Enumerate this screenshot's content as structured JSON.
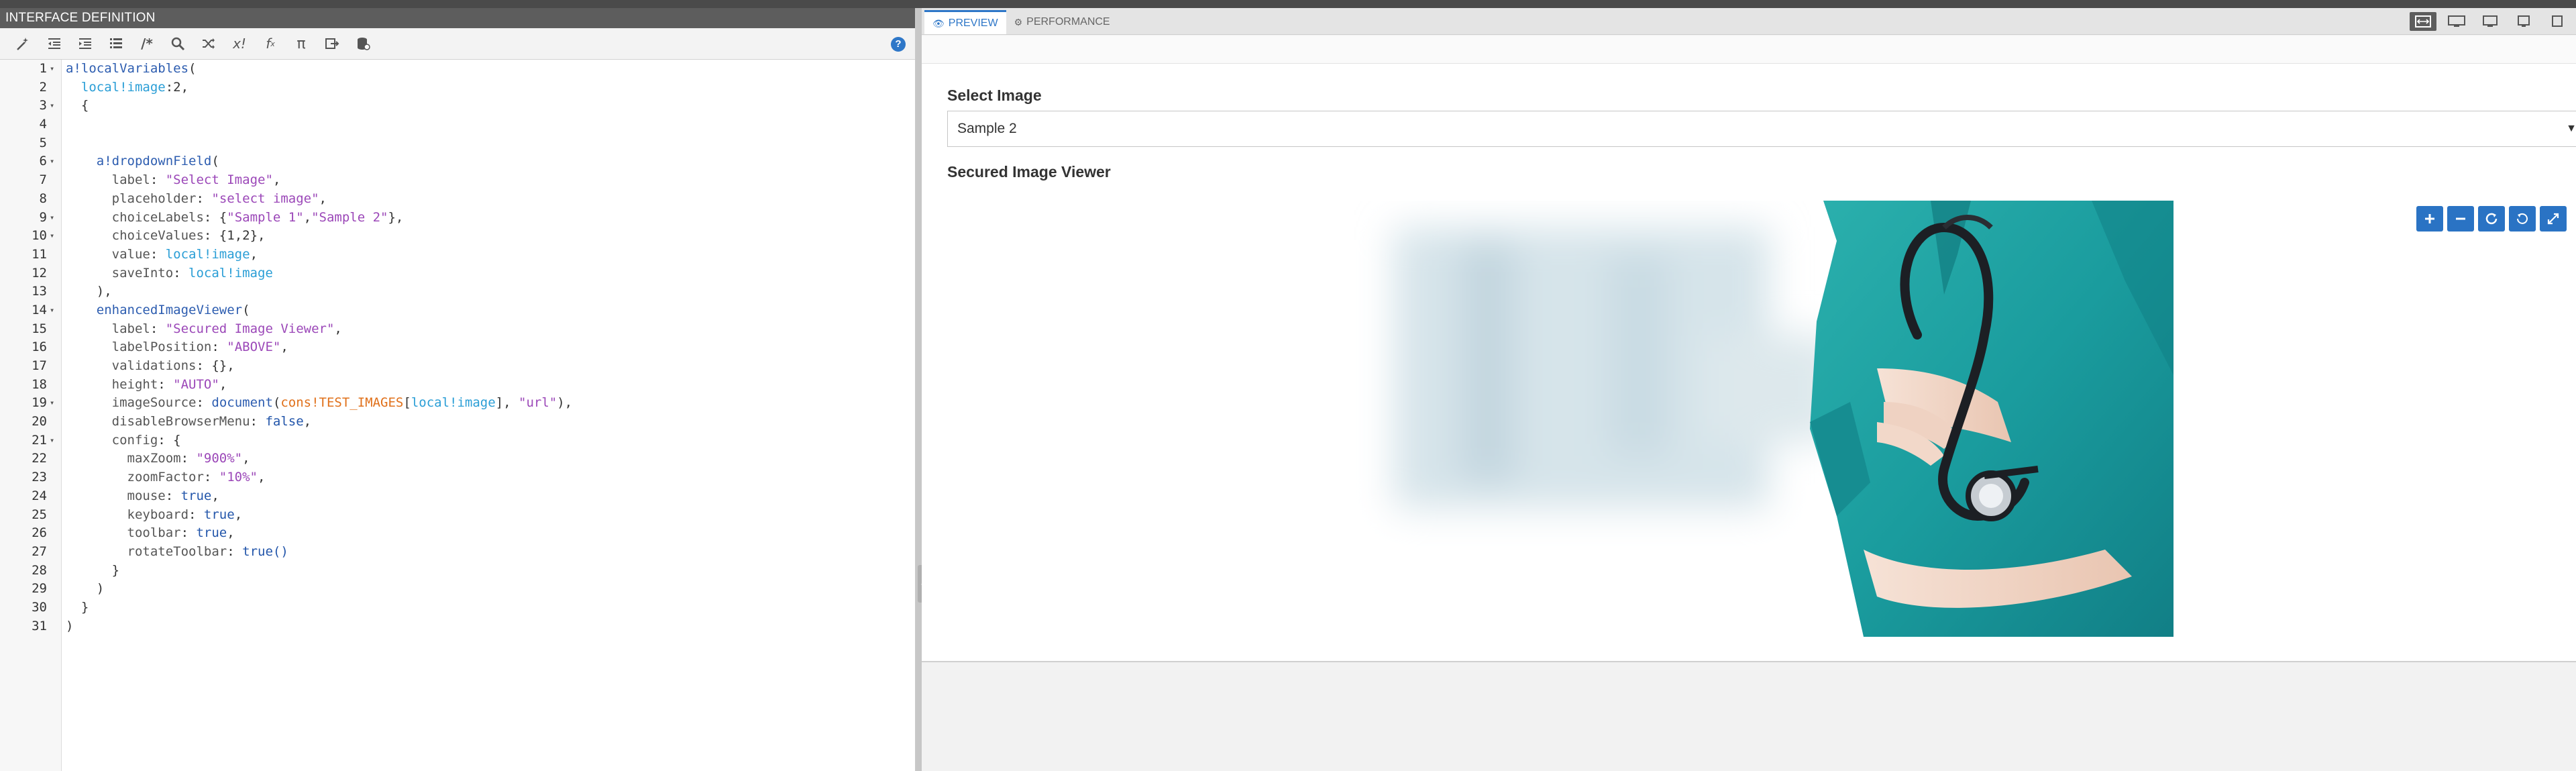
{
  "editor": {
    "title": "INTERFACE DEFINITION",
    "help_label": "?",
    "toolbar_icons": [
      "wand-icon",
      "outdent-icon",
      "indent-icon",
      "list-icon",
      "comment-icon",
      "search-icon",
      "shuffle-icon",
      "expression-icon",
      "function-icon",
      "pi-icon",
      "export-icon",
      "database-icon"
    ],
    "code": [
      {
        "n": "1",
        "fold": "▾",
        "parts": [
          [
            "fn",
            "a!localVariables"
          ],
          [
            "p",
            "("
          ]
        ]
      },
      {
        "n": "2",
        "fold": "",
        "parts": [
          [
            "p",
            "  "
          ],
          [
            "var",
            "local!image"
          ],
          [
            "p",
            ":2,"
          ]
        ]
      },
      {
        "n": "3",
        "fold": "▾",
        "parts": [
          [
            "p",
            "  {"
          ]
        ]
      },
      {
        "n": "4",
        "fold": "",
        "parts": []
      },
      {
        "n": "5",
        "fold": "",
        "parts": []
      },
      {
        "n": "6",
        "fold": "▾",
        "parts": [
          [
            "p",
            "    "
          ],
          [
            "fn",
            "a!dropdownField"
          ],
          [
            "p",
            "("
          ]
        ]
      },
      {
        "n": "7",
        "fold": "",
        "parts": [
          [
            "p",
            "      "
          ],
          [
            "key",
            "label"
          ],
          [
            "p",
            ": "
          ],
          [
            "str",
            "\"Select Image\""
          ],
          [
            "p",
            ","
          ]
        ]
      },
      {
        "n": "8",
        "fold": "",
        "parts": [
          [
            "p",
            "      "
          ],
          [
            "key",
            "placeholder"
          ],
          [
            "p",
            ": "
          ],
          [
            "str",
            "\"select image\""
          ],
          [
            "p",
            ","
          ]
        ]
      },
      {
        "n": "9",
        "fold": "▾",
        "parts": [
          [
            "p",
            "      "
          ],
          [
            "key",
            "choiceLabels"
          ],
          [
            "p",
            ": {"
          ],
          [
            "str",
            "\"Sample 1\""
          ],
          [
            "p",
            ","
          ],
          [
            "str",
            "\"Sample 2\""
          ],
          [
            "p",
            "},"
          ]
        ]
      },
      {
        "n": "10",
        "fold": "▾",
        "parts": [
          [
            "p",
            "      "
          ],
          [
            "key",
            "choiceValues"
          ],
          [
            "p",
            ": {"
          ],
          [
            "num",
            "1,2"
          ],
          [
            "p",
            "},"
          ]
        ]
      },
      {
        "n": "11",
        "fold": "",
        "parts": [
          [
            "p",
            "      "
          ],
          [
            "key",
            "value"
          ],
          [
            "p",
            ": "
          ],
          [
            "var",
            "local!image"
          ],
          [
            "p",
            ","
          ]
        ]
      },
      {
        "n": "12",
        "fold": "",
        "parts": [
          [
            "p",
            "      "
          ],
          [
            "key",
            "saveInto"
          ],
          [
            "p",
            ": "
          ],
          [
            "var",
            "local!image"
          ]
        ]
      },
      {
        "n": "13",
        "fold": "",
        "parts": [
          [
            "p",
            "    ),"
          ]
        ]
      },
      {
        "n": "14",
        "fold": "▾",
        "parts": [
          [
            "p",
            "    "
          ],
          [
            "fn",
            "enhancedImageViewer"
          ],
          [
            "p",
            "("
          ]
        ]
      },
      {
        "n": "15",
        "fold": "",
        "parts": [
          [
            "p",
            "      "
          ],
          [
            "key",
            "label"
          ],
          [
            "p",
            ": "
          ],
          [
            "str",
            "\"Secured Image Viewer\""
          ],
          [
            "p",
            ","
          ]
        ]
      },
      {
        "n": "16",
        "fold": "",
        "parts": [
          [
            "p",
            "      "
          ],
          [
            "key",
            "labelPosition"
          ],
          [
            "p",
            ": "
          ],
          [
            "str",
            "\"ABOVE\""
          ],
          [
            "p",
            ","
          ]
        ]
      },
      {
        "n": "17",
        "fold": "",
        "parts": [
          [
            "p",
            "      "
          ],
          [
            "key",
            "validations"
          ],
          [
            "p",
            ": {},"
          ]
        ]
      },
      {
        "n": "18",
        "fold": "",
        "parts": [
          [
            "p",
            "      "
          ],
          [
            "key",
            "height"
          ],
          [
            "p",
            ": "
          ],
          [
            "str",
            "\"AUTO\""
          ],
          [
            "p",
            ","
          ]
        ]
      },
      {
        "n": "19",
        "fold": "▾",
        "parts": [
          [
            "p",
            "      "
          ],
          [
            "key",
            "imageSource"
          ],
          [
            "p",
            ": "
          ],
          [
            "fn",
            "document"
          ],
          [
            "p",
            "("
          ],
          [
            "const",
            "cons!TEST_IMAGES"
          ],
          [
            "p",
            "["
          ],
          [
            "var",
            "local!image"
          ],
          [
            "p",
            "], "
          ],
          [
            "str",
            "\"url\""
          ],
          [
            "p",
            "),"
          ]
        ]
      },
      {
        "n": "20",
        "fold": "",
        "parts": [
          [
            "p",
            "      "
          ],
          [
            "key",
            "disableBrowserMenu"
          ],
          [
            "p",
            ": "
          ],
          [
            "bool",
            "false"
          ],
          [
            "p",
            ","
          ]
        ]
      },
      {
        "n": "21",
        "fold": "▾",
        "parts": [
          [
            "p",
            "      "
          ],
          [
            "key",
            "config"
          ],
          [
            "p",
            ": {"
          ]
        ]
      },
      {
        "n": "22",
        "fold": "",
        "parts": [
          [
            "p",
            "        "
          ],
          [
            "key",
            "maxZoom"
          ],
          [
            "p",
            ": "
          ],
          [
            "str",
            "\"900%\""
          ],
          [
            "p",
            ","
          ]
        ]
      },
      {
        "n": "23",
        "fold": "",
        "parts": [
          [
            "p",
            "        "
          ],
          [
            "key",
            "zoomFactor"
          ],
          [
            "p",
            ": "
          ],
          [
            "str",
            "\"10%\""
          ],
          [
            "p",
            ","
          ]
        ]
      },
      {
        "n": "24",
        "fold": "",
        "parts": [
          [
            "p",
            "        "
          ],
          [
            "key",
            "mouse"
          ],
          [
            "p",
            ": "
          ],
          [
            "bool",
            "true"
          ],
          [
            "p",
            ","
          ]
        ]
      },
      {
        "n": "25",
        "fold": "",
        "parts": [
          [
            "p",
            "        "
          ],
          [
            "key",
            "keyboard"
          ],
          [
            "p",
            ": "
          ],
          [
            "bool",
            "true"
          ],
          [
            "p",
            ","
          ]
        ]
      },
      {
        "n": "26",
        "fold": "",
        "parts": [
          [
            "p",
            "        "
          ],
          [
            "key",
            "toolbar"
          ],
          [
            "p",
            ": "
          ],
          [
            "bool",
            "true"
          ],
          [
            "p",
            ","
          ]
        ]
      },
      {
        "n": "27",
        "fold": "",
        "parts": [
          [
            "p",
            "        "
          ],
          [
            "key",
            "rotateToolbar"
          ],
          [
            "p",
            ": "
          ],
          [
            "bool",
            "true()"
          ]
        ]
      },
      {
        "n": "28",
        "fold": "",
        "parts": [
          [
            "p",
            "      }"
          ]
        ]
      },
      {
        "n": "29",
        "fold": "",
        "parts": [
          [
            "p",
            "    )"
          ]
        ]
      },
      {
        "n": "30",
        "fold": "",
        "parts": [
          [
            "p",
            "  }"
          ]
        ]
      },
      {
        "n": "31",
        "fold": "",
        "parts": [
          [
            "p",
            ")"
          ]
        ]
      }
    ]
  },
  "preview": {
    "tabs": [
      {
        "label": "PREVIEW",
        "icon": "eye-icon",
        "active": true
      },
      {
        "label": "PERFORMANCE",
        "icon": "gauge-icon",
        "active": false
      }
    ],
    "device_icons": [
      "fit-width-icon",
      "desktop-wide-icon",
      "desktop-icon",
      "tablet-icon",
      "phone-icon"
    ],
    "dropdown_label": "Select Image",
    "dropdown_value": "Sample 2",
    "viewer_label": "Secured Image Viewer",
    "viewer_tools": [
      "zoom-in-icon",
      "zoom-out-icon",
      "rotate-right-icon",
      "rotate-left-icon",
      "fullscreen-icon"
    ],
    "image_subject": "nurse with stethoscope",
    "colors": {
      "accent": "#2e77c8",
      "scrub": "#1fa3a3"
    }
  }
}
